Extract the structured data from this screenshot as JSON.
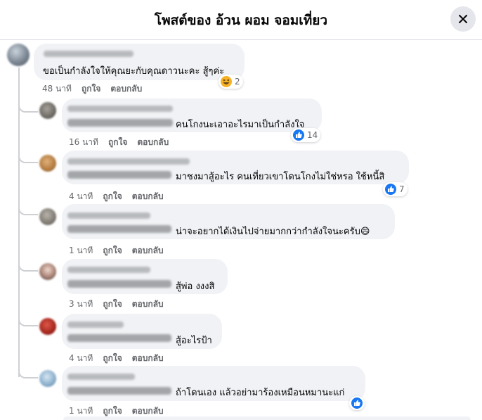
{
  "header": {
    "title": "โพสต์ของ อ้วน ผอม จอมเที่ยว"
  },
  "actions": {
    "like": "ถูกใจ",
    "reply": "ตอบกลับ"
  },
  "comments": [
    {
      "time": "48 นาที",
      "text": "ขอเป็นกำลังใจให้คุณยะกับคุณดาวนะคะ สู้ๆค่ะ",
      "reaction": "haha",
      "reaction_count": "2"
    },
    {
      "time": "16 นาที",
      "text": "คนโกงนะเอาอะไรมาเป็นกำลังใจ",
      "reaction": "like",
      "reaction_count": "14"
    },
    {
      "time": "4 นาที",
      "text": "มาชงมาสู้อะไร คนเที่ยวเขาโดนโกงไม่ใช่หรอ ใช้หนี้สิ",
      "reaction": "like",
      "reaction_count": "7"
    },
    {
      "time": "1 นาที",
      "text": "น่าจะอยากได้เงินไปจ่ายมากกว่ากำลังใจนะครับ😄"
    },
    {
      "time": "3 นาที",
      "text": "สู้พ่อ งงงสิ"
    },
    {
      "time": "4 นาที",
      "text": "สู้อะไรป้า"
    },
    {
      "time": "1 นาที",
      "text": "ถ้าโดนเอง แล้วอย่ามาร้องเหมือนหมานะแก่",
      "reaction": "like"
    }
  ],
  "colors": {
    "bubble": "#f0f2f5",
    "like_blue": "#1877f2",
    "haha_yellow": "#f7b125",
    "meta_gray": "#65676b"
  }
}
